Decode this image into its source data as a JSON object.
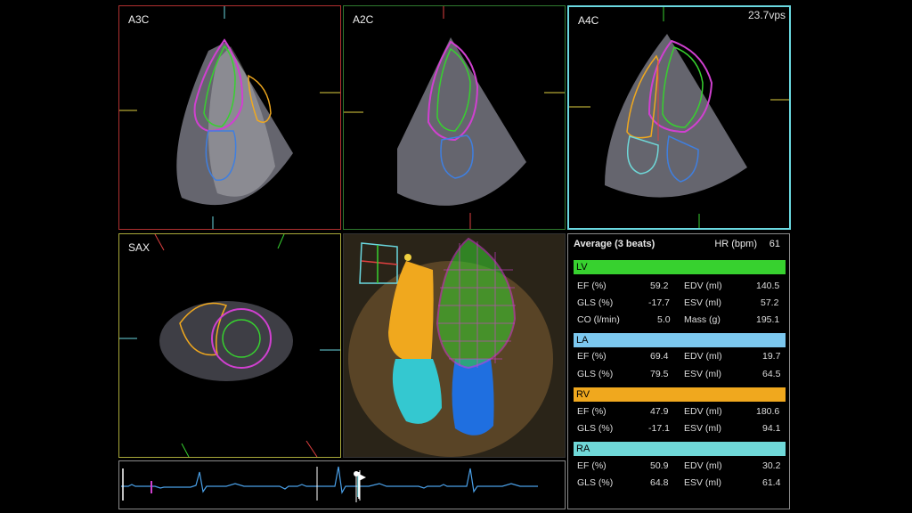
{
  "fps": "23.7vps",
  "views": {
    "a3c": "A3C",
    "a2c": "A2C",
    "a4c": "A4C",
    "sax": "SAX"
  },
  "colors": {
    "a3c_border": "#b03030",
    "a2c_border": "#2f7a2f",
    "a4c_border": "#6ad8e0",
    "sax_border": "#a9a93a",
    "lv": "#37d12f",
    "la": "#7cc8ef",
    "rv": "#f0a81e",
    "ra": "#6fd8d8",
    "endo": "#d040d0"
  },
  "summary": {
    "title": "Average (3 beats)",
    "hr_label": "HR (bpm)",
    "hr_value": "61",
    "sections": [
      {
        "name": "LV",
        "rows": [
          {
            "l1": "EF (%)",
            "v1": "59.2",
            "l2": "EDV (ml)",
            "v2": "140.5"
          },
          {
            "l1": "GLS (%)",
            "v1": "-17.7",
            "l2": "ESV (ml)",
            "v2": "57.2"
          },
          {
            "l1": "CO (l/min)",
            "v1": "5.0",
            "l2": "Mass (g)",
            "v2": "195.1"
          }
        ]
      },
      {
        "name": "LA",
        "rows": [
          {
            "l1": "EF (%)",
            "v1": "69.4",
            "l2": "EDV (ml)",
            "v2": "19.7"
          },
          {
            "l1": "GLS (%)",
            "v1": "79.5",
            "l2": "ESV (ml)",
            "v2": "64.5"
          }
        ]
      },
      {
        "name": "RV",
        "rows": [
          {
            "l1": "EF (%)",
            "v1": "47.9",
            "l2": "EDV (ml)",
            "v2": "180.6"
          },
          {
            "l1": "GLS (%)",
            "v1": "-17.1",
            "l2": "ESV (ml)",
            "v2": "94.1"
          }
        ]
      },
      {
        "name": "RA",
        "rows": [
          {
            "l1": "EF (%)",
            "v1": "50.9",
            "l2": "EDV (ml)",
            "v2": "30.2"
          },
          {
            "l1": "GLS (%)",
            "v1": "64.8",
            "l2": "ESV (ml)",
            "v2": "61.4"
          }
        ]
      }
    ]
  }
}
